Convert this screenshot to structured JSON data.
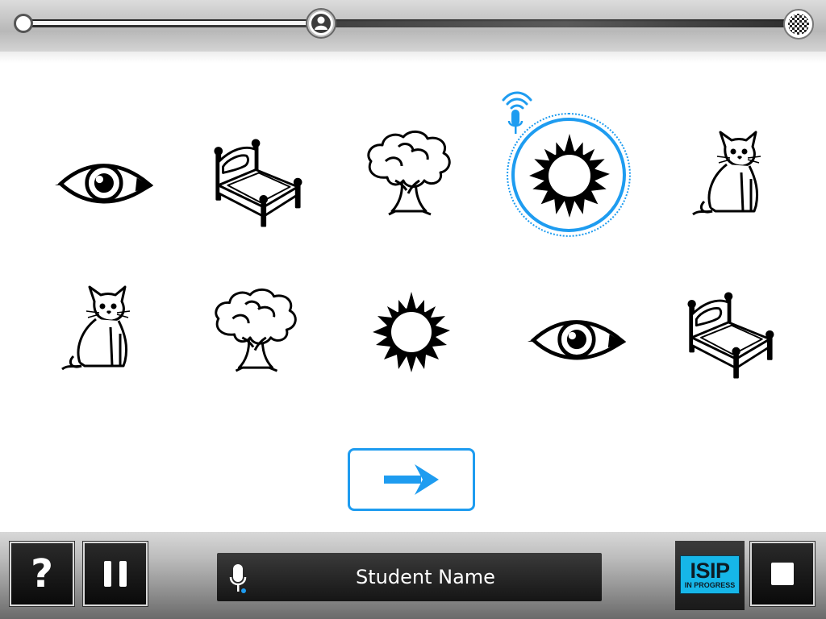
{
  "progress": {
    "value": 0.38,
    "start_icon": "start-node-icon",
    "current_icon": "student-avatar-icon",
    "finish_icon": "checkered-flag-icon"
  },
  "grid": {
    "row1": [
      "eye",
      "bed",
      "tree",
      "sun",
      "cat"
    ],
    "row2": [
      "cat",
      "tree",
      "sun",
      "eye",
      "bed"
    ],
    "selected": "sun",
    "selected_icon": "listening-microphone-icon"
  },
  "next_button": {
    "icon": "right-arrow-icon"
  },
  "bottom": {
    "help_label": "?",
    "pause_icon": "pause-icon",
    "student_name": "Student Name",
    "mic_icon": "microphone-icon",
    "status_logo": "ISIP",
    "status_text": "IN PROGRESS",
    "stop_icon": "stop-icon"
  },
  "colors": {
    "accent": "#1e9cf0",
    "badge": "#16b6e8",
    "bar_dark": "#141414"
  }
}
